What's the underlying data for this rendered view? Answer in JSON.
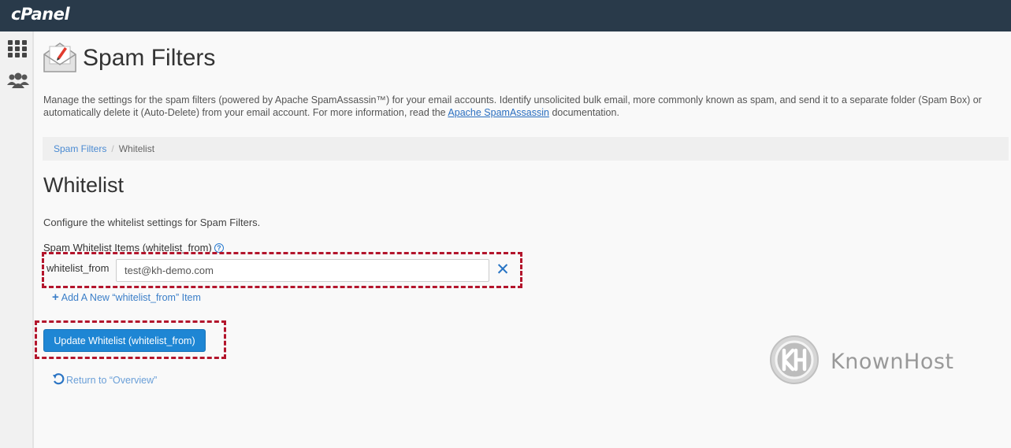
{
  "header": {
    "logo_text": "cPanel"
  },
  "sidebar": {
    "icons": [
      "grid-icon",
      "users-icon"
    ]
  },
  "page": {
    "title": "Spam Filters",
    "description_part1": "Manage the settings for the spam filters (powered by Apache SpamAssassin™) for your email accounts. Identify unsolicited bulk email, more commonly known as spam, and send it to a separate folder (Spam Box) or automatically delete it (Auto-Delete) from your email account. For more information, read the ",
    "description_link": "Apache SpamAssassin",
    "description_part2": " documentation."
  },
  "breadcrumb": {
    "parent": "Spam Filters",
    "separator": "/",
    "current": "Whitelist"
  },
  "section": {
    "title": "Whitelist",
    "configure_text": "Configure the whitelist settings for Spam Filters.",
    "items_label": "Spam Whitelist Items (whitelist_from)",
    "help_glyph": "?"
  },
  "row": {
    "label": "whitelist_from",
    "value": "test@kh-demo.com",
    "remove_glyph": "✕"
  },
  "actions": {
    "add_plus": "+",
    "add_label": "Add A New “whitelist_from” Item",
    "update_label": "Update Whitelist (whitelist_from)",
    "return_label": "Return to “Overview”"
  },
  "watermark": {
    "text": "KnownHost"
  },
  "colors": {
    "topbar": "#293a4a",
    "accent": "#1e86d4",
    "highlight_dash": "#b3152c",
    "link": "#3a7ec8"
  }
}
